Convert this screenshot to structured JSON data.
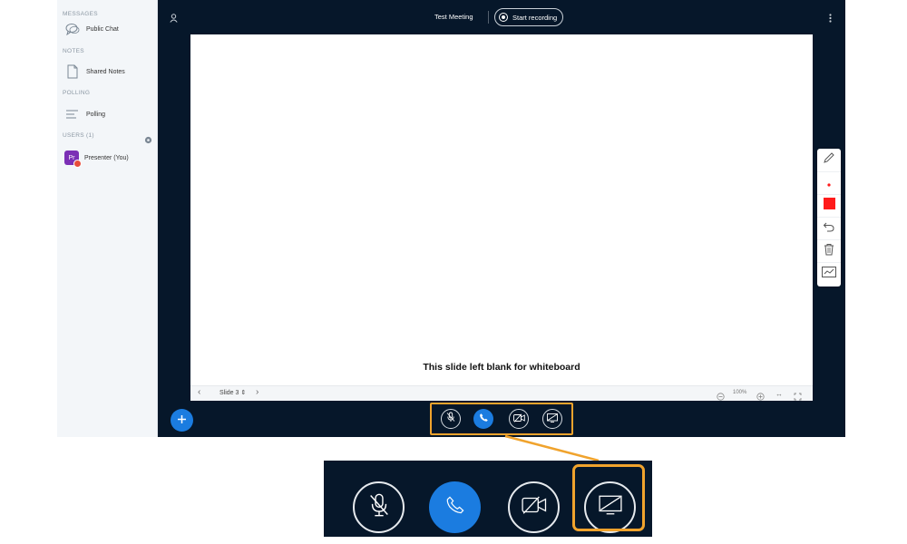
{
  "sidebar": {
    "messages_title": "MESSAGES",
    "public_chat": "Public Chat",
    "notes_title": "NOTES",
    "shared_notes": "Shared Notes",
    "polling_title": "POLLING",
    "polling": "Polling",
    "users_title": "USERS (1)",
    "presenter_initials": "Pr",
    "presenter_name": "Presenter (You)"
  },
  "header": {
    "meeting_title": "Test Meeting",
    "record_label": "Start recording"
  },
  "whiteboard": {
    "blank_text": "This slide left blank for whiteboard",
    "slide_label": "Slide 3 ⇕",
    "zoom_level": "100%"
  },
  "colors": {
    "dark_bg": "#06172a",
    "accent_blue": "#1b7ce0",
    "highlight": "#f0a32d",
    "tool_red": "#ff1a1a",
    "presenter_purple": "#7b2fb5"
  },
  "controls": [
    "muted-microphone-icon",
    "phone-icon",
    "video-off-icon",
    "screen-share-icon"
  ]
}
